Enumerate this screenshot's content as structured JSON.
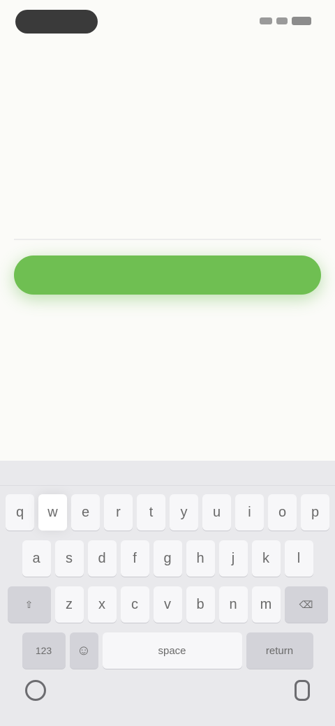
{
  "status_bar": {},
  "nav": {
    "back_label": "",
    "help_label": ""
  },
  "page": {
    "title": "",
    "description": ""
  },
  "form": {
    "field_label": "",
    "field_value": "",
    "field_placeholder": ""
  },
  "button": {
    "label": ""
  },
  "colors": {
    "accent": "#6fbf52",
    "background": "#fbfbf8"
  },
  "keyboard": {
    "row1": [
      "q",
      "w",
      "e",
      "r",
      "t",
      "y",
      "u",
      "i",
      "o",
      "p"
    ],
    "row2": [
      "a",
      "s",
      "d",
      "f",
      "g",
      "h",
      "j",
      "k",
      "l"
    ],
    "row3": [
      "z",
      "x",
      "c",
      "v",
      "b",
      "n",
      "m"
    ],
    "shift_label": "⇧",
    "delete_label": "⌫",
    "numbers_label": "123",
    "emoji_label": "☺",
    "space_label": "space",
    "return_label": "return",
    "globe_icon": "globe-icon",
    "mic_icon": "mic-icon"
  }
}
